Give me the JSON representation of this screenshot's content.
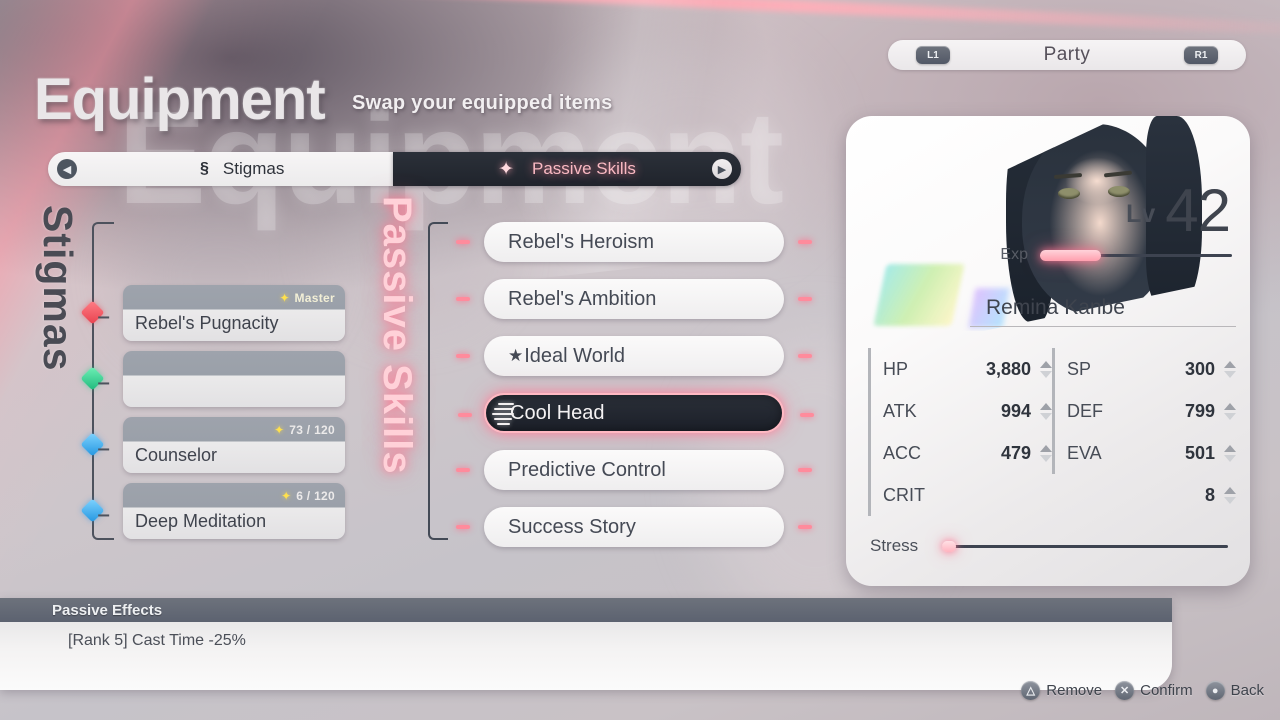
{
  "header": {
    "title": "Equipment",
    "subtitle": "Swap your equipped items",
    "watermark": "Equipment"
  },
  "party_selector": {
    "label": "Party",
    "left_bumper": "L1",
    "right_bumper": "R1"
  },
  "tabs": {
    "left_arrow_icon": "caret-left-icon",
    "right_arrow_icon": "caret-right-icon",
    "items": [
      {
        "label": "Stigmas",
        "icon": "stigma-icon",
        "selected": false
      },
      {
        "label": "Passive Skills",
        "icon": "sparkle-icon",
        "selected": true
      }
    ]
  },
  "stigmas_section": {
    "vertical_label": "Stigmas",
    "slots": [
      {
        "name": "Rebel's Pugnacity",
        "rank": "Master",
        "node_color": "#e8414e",
        "empty": false
      },
      {
        "name": "",
        "rank": "",
        "node_color": "#1fb97c",
        "empty": true
      },
      {
        "name": "Counselor",
        "rank": "73 / 120",
        "node_color": "#2496e0",
        "empty": false
      },
      {
        "name": "Deep Meditation",
        "rank": "6 / 120",
        "node_color": "#2496e0",
        "empty": false
      }
    ]
  },
  "passive_section": {
    "vertical_label": "Passive Skills",
    "skills": [
      {
        "label": "Rebel's Heroism",
        "selected": false,
        "prefix": ""
      },
      {
        "label": "Rebel's Ambition",
        "selected": false,
        "prefix": ""
      },
      {
        "label": "Ideal World",
        "selected": false,
        "prefix": "★"
      },
      {
        "label": "Cool Head",
        "selected": true,
        "prefix": ""
      },
      {
        "label": "Predictive Control",
        "selected": false,
        "prefix": ""
      },
      {
        "label": "Success Story",
        "selected": false,
        "prefix": ""
      }
    ]
  },
  "character": {
    "name": "Remina Kanbe",
    "level_label": "Lv",
    "level_value": "42",
    "exp_label": "Exp",
    "exp_percent": 32,
    "stress_label": "Stress",
    "stress_percent": 4,
    "stats": [
      {
        "key": "HP",
        "value": "3,880"
      },
      {
        "key": "SP",
        "value": "300"
      },
      {
        "key": "ATK",
        "value": "994"
      },
      {
        "key": "DEF",
        "value": "799"
      },
      {
        "key": "ACC",
        "value": "479"
      },
      {
        "key": "EVA",
        "value": "501"
      },
      {
        "key": "CRIT",
        "value": "8"
      }
    ]
  },
  "passive_effects": {
    "title": "Passive Effects",
    "entries": [
      {
        "rank": "[Rank 5]",
        "text": "Cast Time -25%"
      }
    ]
  },
  "footer_prompts": [
    {
      "glyph": "△",
      "icon": "triangle-button-icon",
      "label": "Remove"
    },
    {
      "glyph": "✕",
      "icon": "cross-button-icon",
      "label": "Confirm"
    },
    {
      "glyph": "●",
      "icon": "circle-button-icon",
      "label": "Back"
    }
  ],
  "colors": {
    "accent_pink": "#ff8b9c",
    "dark_panel": "#22262f",
    "rail": "#4d525d"
  }
}
